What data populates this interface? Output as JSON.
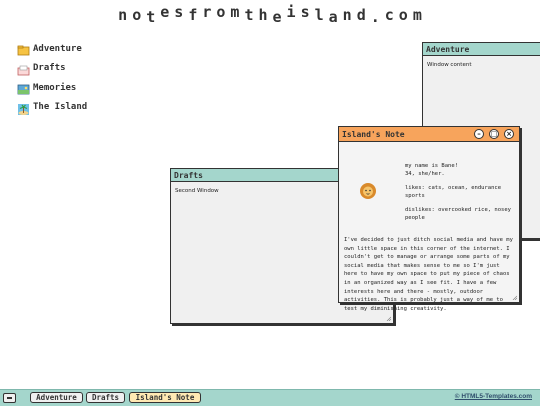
{
  "site": {
    "title": "notesfromtheisland.com"
  },
  "desktop": {
    "icons": [
      {
        "label": "Adventure",
        "icon": "folder-icon"
      },
      {
        "label": "Drafts",
        "icon": "drafts-icon"
      },
      {
        "label": "Memories",
        "icon": "memories-icon"
      },
      {
        "label": "The Island",
        "icon": "island-icon"
      }
    ]
  },
  "windows": {
    "adventure": {
      "title": "Adventure",
      "content": "Window content"
    },
    "drafts": {
      "title": "Drafts",
      "content": "Second Window"
    },
    "note": {
      "title": "Island's Note",
      "profile": {
        "name": "my name is Bane!",
        "age": "34, she/her.",
        "likes": "likes: cats, ocean, endurance sports",
        "dislikes": "dislikes: overcooked rice, nosey people"
      },
      "about": "I've decided to just ditch social media and have my own little space in this corner of the internet. I couldn't get to manage or arrange some parts of my social media that makes sense to me so I'm just here to have my own space to put my piece of chaos in an organized way as I see fit. I have a few interests here and there - mostly, outdoor activities. This is probably just a way of me to test my diminishing creativity."
    }
  },
  "taskbar": {
    "buttons": [
      "Adventure",
      "Drafts",
      "Island's Note"
    ],
    "credit": "© HTML5-Templates.com"
  },
  "colors": {
    "titlebar_teal": "#a4d6cc",
    "titlebar_orange": "#f7a45c",
    "taskbar": "#a4d6cc"
  }
}
